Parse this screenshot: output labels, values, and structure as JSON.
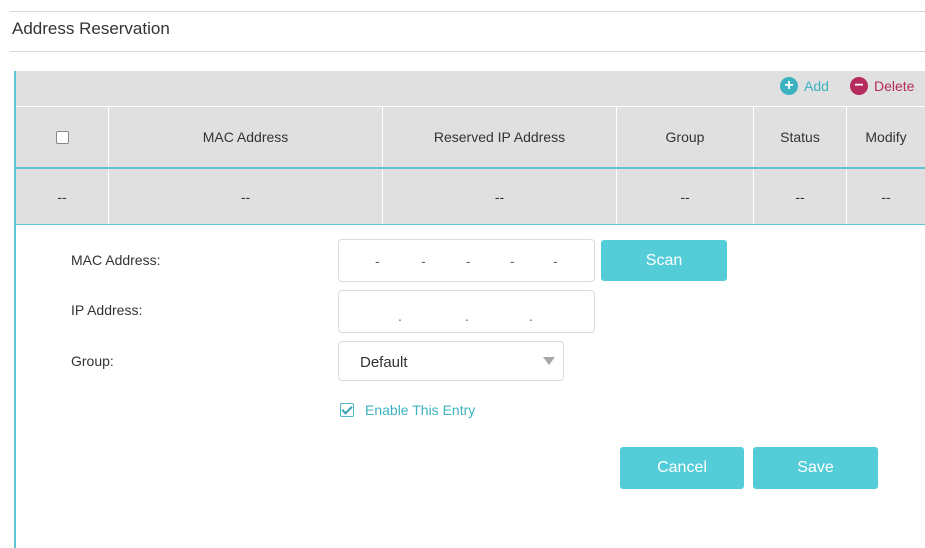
{
  "page": {
    "title": "Address Reservation"
  },
  "toolbar": {
    "add_label": "Add",
    "delete_label": "Delete"
  },
  "table": {
    "columns": [
      "MAC Address",
      "Reserved IP Address",
      "Group",
      "Status",
      "Modify"
    ],
    "rows": [
      [
        "--",
        "--",
        "--",
        "--",
        "--",
        "--"
      ]
    ]
  },
  "form": {
    "mac_label": "MAC Address:",
    "mac_separator": "-",
    "ip_label": "IP Address:",
    "ip_separator": ".",
    "group_label": "Group:",
    "group_value": "Default",
    "scan_label": "Scan",
    "enable_label": "Enable This Entry",
    "enable_checked": true,
    "cancel_label": "Cancel",
    "save_label": "Save"
  },
  "colors": {
    "accent": "#55cdd8",
    "add": "#3cb2c1",
    "delete": "#b52b5d",
    "table_bg": "#e0e0e0"
  },
  "icons": {
    "add": "plus-circle-icon",
    "delete": "minus-circle-icon",
    "select": "triangle-down-icon",
    "checkbox": "checkmark-icon"
  }
}
